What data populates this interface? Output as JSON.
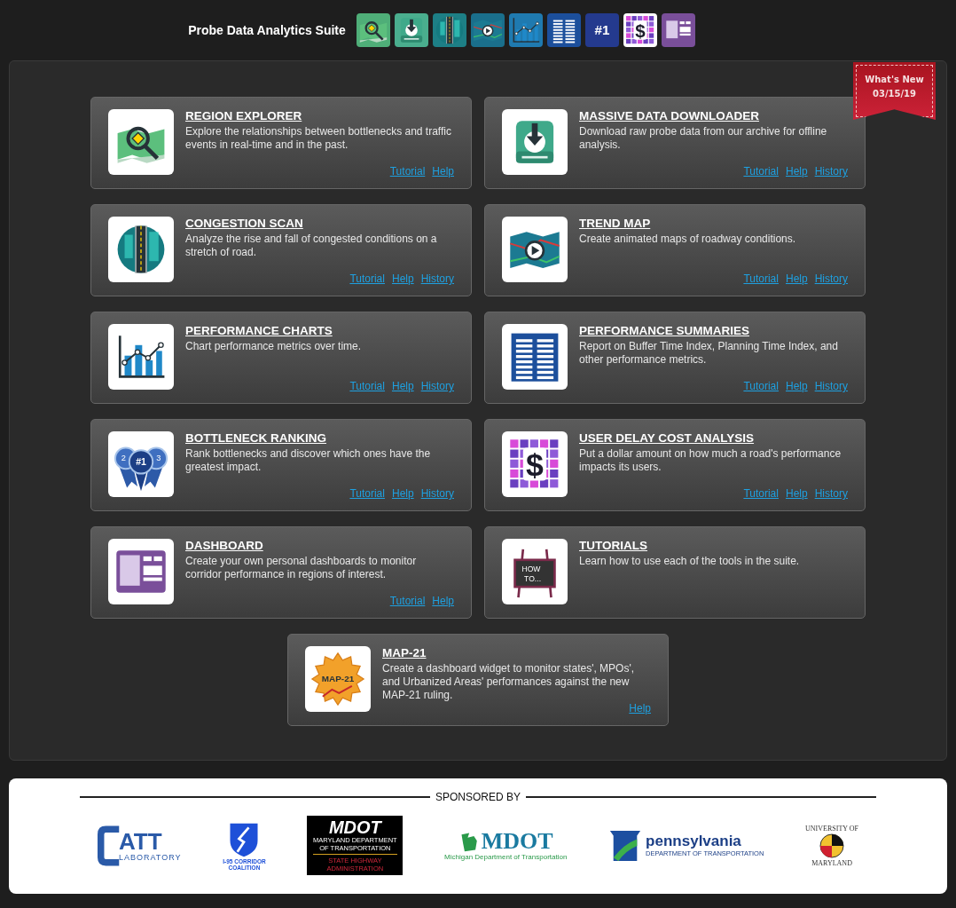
{
  "header": {
    "title": "Probe Data Analytics Suite",
    "tools": [
      {
        "kind": "region"
      },
      {
        "kind": "download"
      },
      {
        "kind": "scan"
      },
      {
        "kind": "trend"
      },
      {
        "kind": "charts"
      },
      {
        "kind": "summaries"
      },
      {
        "kind": "ranking",
        "icon_text": [
          "#1"
        ]
      },
      {
        "kind": "cost",
        "icon_text": [
          "$"
        ]
      },
      {
        "kind": "dashboard"
      }
    ]
  },
  "ribbon": {
    "title": "What's New",
    "date": "03/15/19"
  },
  "cards": [
    {
      "kind": "region",
      "title": "REGION EXPLORER",
      "description": "Explore the relationships between bottlenecks and traffic events in real-time and in the past.",
      "links": [
        "Tutorial",
        "Help"
      ]
    },
    {
      "kind": "download",
      "title": "MASSIVE DATA DOWNLOADER",
      "description": "Download raw probe data from our archive for offline analysis.",
      "links": [
        "Tutorial",
        "Help",
        "History"
      ]
    },
    {
      "kind": "scan",
      "title": "CONGESTION SCAN",
      "description": "Analyze the rise and fall of congested conditions on a stretch of road.",
      "links": [
        "Tutorial",
        "Help",
        "History"
      ]
    },
    {
      "kind": "trend",
      "title": "TREND MAP",
      "description": "Create animated maps of roadway conditions.",
      "links": [
        "Tutorial",
        "Help",
        "History"
      ]
    },
    {
      "kind": "charts",
      "title": "PERFORMANCE CHARTS",
      "description": "Chart performance metrics over time.",
      "links": [
        "Tutorial",
        "Help",
        "History"
      ]
    },
    {
      "kind": "summaries",
      "title": "PERFORMANCE SUMMARIES",
      "description": "Report on Buffer Time Index, Planning Time Index, and other performance metrics.",
      "links": [
        "Tutorial",
        "Help",
        "History"
      ]
    },
    {
      "kind": "ranking",
      "icon_text": [
        "2",
        "#1",
        "3"
      ],
      "title": "BOTTLENECK RANKING",
      "description": "Rank bottlenecks and discover which ones have the greatest impact.",
      "links": [
        "Tutorial",
        "Help",
        "History"
      ]
    },
    {
      "kind": "cost",
      "icon_text": [
        "$"
      ],
      "title": "USER DELAY COST ANALYSIS",
      "description": "Put a dollar amount on how much a road's performance impacts its users.",
      "links": [
        "Tutorial",
        "Help",
        "History"
      ]
    },
    {
      "kind": "dashboard",
      "title": "DASHBOARD",
      "description": "Create your own personal dashboards to monitor corridor performance in regions of interest.",
      "links": [
        "Tutorial",
        "Help"
      ]
    },
    {
      "kind": "tutorials",
      "icon_text": [
        "HOW",
        "TO..."
      ],
      "title": "TUTORIALS",
      "description": "Learn how to use each of the tools in the suite."
    },
    {
      "kind": "map21",
      "icon_text": [
        "MAP-21"
      ],
      "title": "MAP-21",
      "description": "Create a dashboard widget to monitor states', MPOs', and Urbanized Areas' performances against the new MAP-21 ruling.",
      "links": [
        "Help"
      ]
    }
  ],
  "sponsors": {
    "heading": "SPONSORED BY",
    "logos": [
      {
        "kind": "catt",
        "lines": [
          "ATT",
          "LABORATORY"
        ]
      },
      {
        "kind": "i95",
        "lines": [
          "I-95 CORRIDOR",
          "COALITION"
        ]
      },
      {
        "kind": "mdot_md",
        "lines": [
          "MDOT",
          "MARYLAND DEPARTMENT",
          "OF TRANSPORTATION",
          "STATE HIGHWAY",
          "ADMINISTRATION"
        ]
      },
      {
        "kind": "mdot_mi",
        "lines": [
          "MDOT",
          "Michigan Department of Transportation"
        ]
      },
      {
        "kind": "penn",
        "lines": [
          "pennsylvania",
          "DEPARTMENT OF TRANSPORTATION"
        ]
      },
      {
        "kind": "umd",
        "lines": [
          "UNIVERSITY OF",
          "MARYLAND"
        ]
      }
    ]
  }
}
